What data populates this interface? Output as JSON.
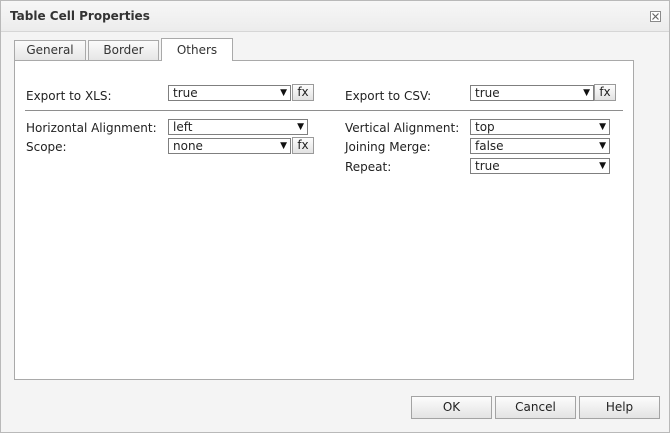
{
  "dialog": {
    "title": "Table Cell Properties"
  },
  "tabs": [
    {
      "label": "General"
    },
    {
      "label": "Border"
    },
    {
      "label": "Others"
    }
  ],
  "fields": {
    "export_xls": {
      "label": "Export to XLS:",
      "value": "true",
      "fx": "fx"
    },
    "export_csv": {
      "label": "Export to CSV:",
      "value": "true",
      "fx": "fx"
    },
    "horizontal_alignment": {
      "label": "Horizontal Alignment:",
      "value": "left"
    },
    "vertical_alignment": {
      "label": "Vertical Alignment:",
      "value": "top"
    },
    "scope": {
      "label": "Scope:",
      "value": "none",
      "fx": "fx"
    },
    "joining_merge": {
      "label": "Joining Merge:",
      "value": "false"
    },
    "repeat": {
      "label": "Repeat:",
      "value": "true"
    }
  },
  "buttons": {
    "ok": "OK",
    "cancel": "Cancel",
    "help": "Help"
  },
  "icons": {
    "dropdown": "dropdown-arrow-icon",
    "close": "close-icon"
  },
  "arrow_glyph": "▼"
}
